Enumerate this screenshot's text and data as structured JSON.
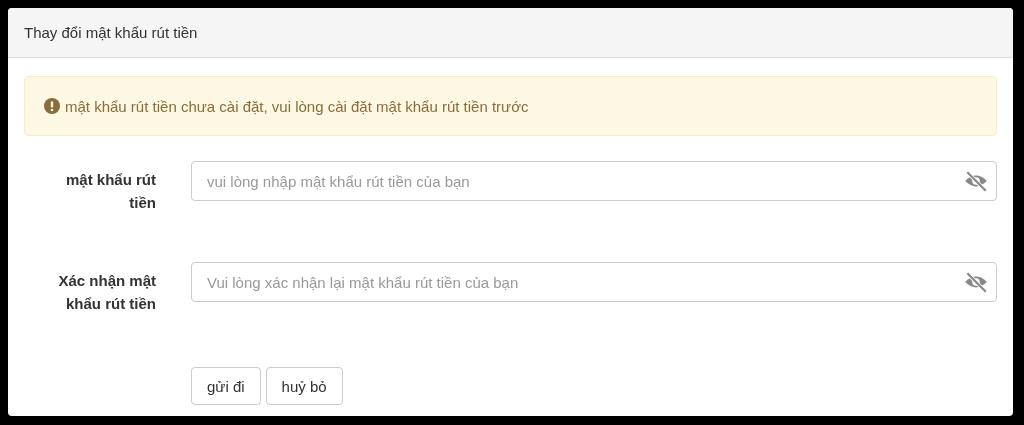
{
  "panel": {
    "title": "Thay đổi mật khẩu rút tiền"
  },
  "alert": {
    "message": "mật khẩu rút tiền chưa cài đặt, vui lòng cài đặt mật khẩu rút tiền trước"
  },
  "fields": [
    {
      "label": "mật khẩu rút tiền",
      "placeholder": "vui lòng nhập mật khẩu rút tiền của bạn"
    },
    {
      "label": "Xác nhận mật khẩu rút tiền",
      "placeholder": "Vui lòng xác nhận lại mật khẩu rút tiền của bạn"
    }
  ],
  "buttons": [
    "gửi đi",
    "huỷ bỏ"
  ]
}
